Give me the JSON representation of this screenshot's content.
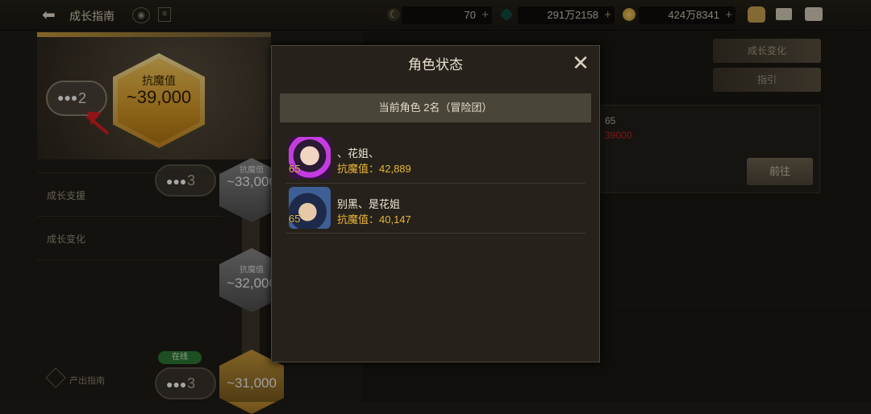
{
  "header": {
    "title": "成长指南",
    "resources": [
      {
        "icon": "moon-icon",
        "value": "70"
      },
      {
        "icon": "gem-icon",
        "value": "291万2158"
      },
      {
        "icon": "coin-icon",
        "value": "424万8341"
      }
    ]
  },
  "banner": {
    "party_count": "2",
    "resist_label": "抗魔值",
    "resist_value": "~39,000"
  },
  "path": {
    "nodes": [
      {
        "count": "3",
        "label": "抗魔值",
        "value": "~33,000"
      },
      {
        "label": "抗魔值",
        "value": "~32,000"
      },
      {
        "count": "3",
        "value": "~31,000",
        "badge": "在线"
      }
    ]
  },
  "sidebar": {
    "items": [
      "成长支援",
      "成长变化",
      "产出指南"
    ]
  },
  "right": {
    "btn1": "成长变化",
    "btn2": "指引",
    "level": "65",
    "red_value": "39000",
    "goto": "前往"
  },
  "modal": {
    "title": "角色状态",
    "close": "✕",
    "header": "当前角色  2名（冒险团）",
    "characters": [
      {
        "level": "65",
        "name": "、花姐、",
        "power": "抗魔值：42,889"
      },
      {
        "level": "65",
        "name": "别黑、是花姐",
        "power": "抗魔值：40,147"
      }
    ]
  },
  "colors": {
    "gold": "#d99a25",
    "power_text": "#e8b43a",
    "annotation_arrow": "#e02020",
    "online_badge": "#2e7a36"
  }
}
